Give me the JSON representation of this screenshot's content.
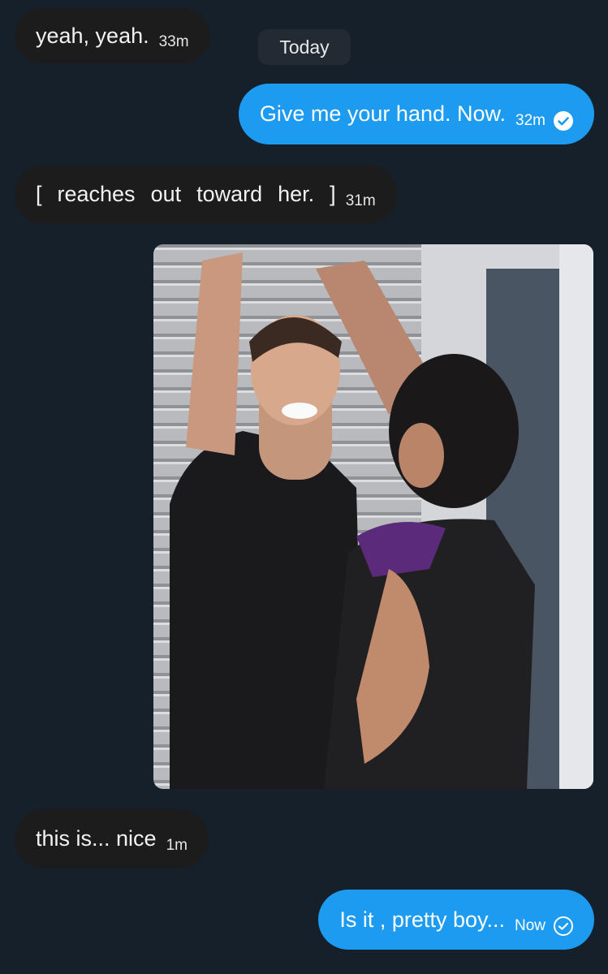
{
  "day_separator": "Today",
  "messages": [
    {
      "text": "yeah, yeah.",
      "time": "33m"
    },
    {
      "text": "Give me your hand. Now.",
      "time": "32m"
    },
    {
      "text": "[  reaches  out  toward  her.  ]",
      "time": "31m"
    },
    {
      "text": "this is... nice",
      "time": "1m"
    },
    {
      "text": "Is it , pretty boy...",
      "time": "Now"
    }
  ],
  "colors": {
    "background": "#16202b",
    "incoming_bubble": "#1c1c1c",
    "outgoing_bubble": "#1d9bf0",
    "separator": "#232a33"
  },
  "icons": {
    "read_receipt": "check-circle-filled-icon",
    "sent_receipt": "check-circle-outline-icon"
  }
}
